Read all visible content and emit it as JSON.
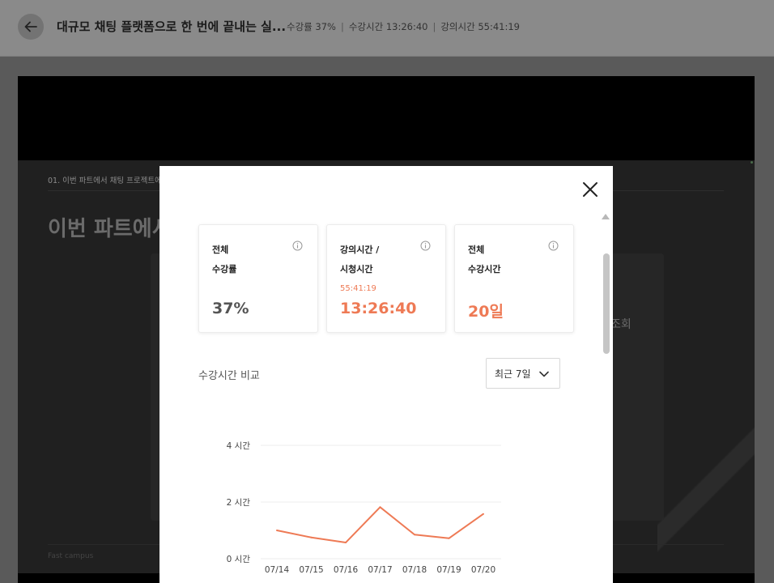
{
  "header": {
    "title": "대규모 채팅 플랫폼으로 한 번에 끝내는 실...",
    "progress": "수강률 37%",
    "watch_time": "수강시간 13:26:40",
    "lecture_time": "강의시간 55:41:19"
  },
  "slide": {
    "breadcrumb": "01. 이번 파트에서 채팅 프로젝트에",
    "heading": "이번 파트에서",
    "right_text": "조회",
    "brand": "Fast campus"
  },
  "modal": {
    "cards": [
      {
        "label_line1": "전체",
        "label_line2": "수강률",
        "sub": "",
        "value": "37%"
      },
      {
        "label_line1": "강의시간 /",
        "label_line2": "시청시간",
        "sub": "55:41:19",
        "value": "13:26:40"
      },
      {
        "label_line1": "전체",
        "label_line2": "수강시간",
        "sub": "",
        "value": "20일"
      }
    ],
    "compare_label": "수강시간 비교",
    "period_selected": "최근 7일"
  },
  "colors": {
    "accent": "#ee7a55",
    "grid": "#eeeeee"
  },
  "icons": {
    "back": "arrow-left-icon",
    "close": "close-icon",
    "info": "info-icon",
    "dropdown": "chevron-down-icon"
  },
  "chart_data": {
    "type": "line",
    "categories": [
      "07/14",
      "07/15",
      "07/16",
      "07/17",
      "07/18",
      "07/19",
      "07/20"
    ],
    "series": [
      {
        "values": [
          1.0,
          0.75,
          0.57,
          1.82,
          0.85,
          0.72,
          1.58
        ]
      }
    ],
    "y_ticks": [
      "0 시간",
      "2 시간",
      "4 시간"
    ],
    "y_tick_values": [
      0,
      2,
      4
    ],
    "ylim": [
      0,
      4
    ],
    "grid": true
  }
}
